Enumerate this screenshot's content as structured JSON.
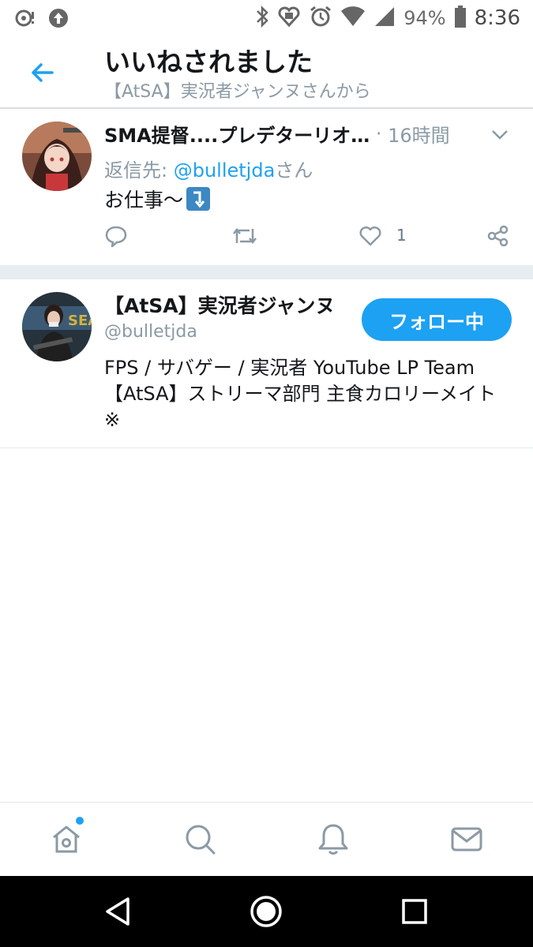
{
  "status_bar": {
    "battery_percent": "94%",
    "time": "8:36",
    "icons": [
      "cast-icon",
      "upload-icon",
      "bluetooth-icon",
      "heart-signal-icon",
      "alarm-icon",
      "wifi-icon",
      "cell-signal-icon",
      "battery-icon"
    ]
  },
  "header": {
    "title": "いいねされました",
    "subtitle": "【AtSA】実況者ジャンヌさんから"
  },
  "tweet": {
    "author_name": "SMA提督....プレデターリオ…",
    "time_sep": " · ",
    "time": "16時間",
    "reply_prefix": "返信先: ",
    "reply_mention": "@bulletjda",
    "reply_suffix": "さん",
    "text": "お仕事〜",
    "emoji": "⤵",
    "like_count": "1"
  },
  "user_card": {
    "name": "【AtSA】実況者ジャンヌ",
    "handle": "@bulletjda",
    "follow_label": "フォロー中",
    "bio": "FPS / サバゲー / 実況者 YouTube LP Team【AtSA】ストリーマ部門 主食カロリーメイト ※"
  },
  "bottom_nav": [
    "home-icon",
    "search-icon",
    "notifications-icon",
    "messages-icon"
  ],
  "colors": {
    "accent": "#1da1f2",
    "text": "#14171a",
    "muted": "#8b9aa5",
    "separator": "#e6ecf0"
  }
}
